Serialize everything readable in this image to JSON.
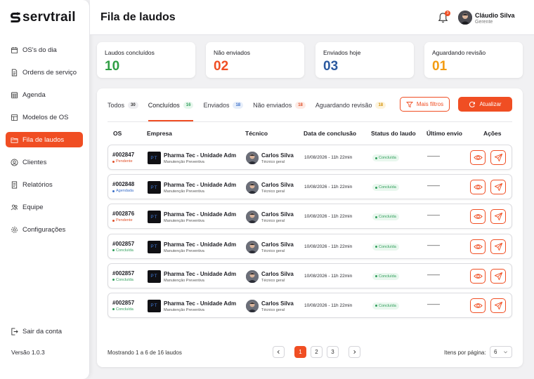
{
  "brand": {
    "name": "servtrail",
    "accent": "#f04e23"
  },
  "sidebar": {
    "items": [
      {
        "label": "OS's do dia",
        "icon": "calendar-icon",
        "active": false
      },
      {
        "label": "Ordens de serviço",
        "icon": "document-icon",
        "active": false
      },
      {
        "label": "Agenda",
        "icon": "calendar-grid-icon",
        "active": false
      },
      {
        "label": "Modelos de OS",
        "icon": "template-icon",
        "active": false
      },
      {
        "label": "Fila de laudos",
        "icon": "folder-icon",
        "active": true
      },
      {
        "label": "Clientes",
        "icon": "user-circle-icon",
        "active": false
      },
      {
        "label": "Relatórios",
        "icon": "report-icon",
        "active": false
      },
      {
        "label": "Equipe",
        "icon": "team-icon",
        "active": false
      },
      {
        "label": "Configurações",
        "icon": "gear-icon",
        "active": false
      }
    ],
    "logout_label": "Sair da conta",
    "version": "Versão 1.0.3"
  },
  "header": {
    "title": "Fila de laudos",
    "notifications_count": "3",
    "user": {
      "name": "Cláudio Silva",
      "role": "Gerente"
    }
  },
  "cards": [
    {
      "label": "Laudos concluídos",
      "value": "10",
      "color": "#2f9e44"
    },
    {
      "label": "Não enviados",
      "value": "02",
      "color": "#f04e23"
    },
    {
      "label": "Enviados hoje",
      "value": "03",
      "color": "#2c5aa0"
    },
    {
      "label": "Aguardando revisão",
      "value": "01",
      "color": "#f39c12"
    }
  ],
  "tabs": [
    {
      "label": "Todos",
      "count": "30",
      "bg": "#ededf0",
      "fg": "#333333",
      "active": false
    },
    {
      "label": "Concluídos",
      "count": "16",
      "bg": "#e6f6ec",
      "fg": "#2f9e5a",
      "active": true
    },
    {
      "label": "Enviados",
      "count": "18",
      "bg": "#e6eefa",
      "fg": "#3b6fc9",
      "active": false
    },
    {
      "label": "Não enviados",
      "count": "18",
      "bg": "#fdeae4",
      "fg": "#e0502a",
      "active": false
    },
    {
      "label": "Aguardando revisão",
      "count": "18",
      "bg": "#fdf3dc",
      "fg": "#d4940c",
      "active": false
    }
  ],
  "buttons": {
    "filters": "Mais filtros",
    "refresh": "Atualizar"
  },
  "table": {
    "headers": [
      "OS",
      "Empresa",
      "Técnico",
      "Data de conclusão",
      "Status do laudo",
      "Último envio",
      "Ações"
    ],
    "rows": [
      {
        "os": "#002847",
        "os_status": "Pendente",
        "os_status_color": "#e0502a",
        "company": "Pharma Tec - Unidade Adm",
        "company_sub": "Manutenção Preventiva",
        "company_logo": "PT",
        "tech": "Carlos Silva",
        "tech_role": "Técnico geral",
        "date": "10/08/2026 - 11h 22min",
        "laudo": "Concluída",
        "last_send": "——"
      },
      {
        "os": "#002848",
        "os_status": "Agendada",
        "os_status_color": "#3b6fc9",
        "company": "Pharma Tec - Unidade Adm",
        "company_sub": "Manutenção Preventiva",
        "company_logo": "PT",
        "tech": "Carlos Silva",
        "tech_role": "Técnico geral",
        "date": "10/08/2026 - 11h 22min",
        "laudo": "Concluída",
        "last_send": "——"
      },
      {
        "os": "#002876",
        "os_status": "Pendente",
        "os_status_color": "#e0502a",
        "company": "Pharma Tec - Unidade Adm",
        "company_sub": "Manutenção Preventiva",
        "company_logo": "PT",
        "tech": "Carlos Silva",
        "tech_role": "Técnico geral",
        "date": "10/08/2026 - 11h 22min",
        "laudo": "Concluída",
        "last_send": "——"
      },
      {
        "os": "#002857",
        "os_status": "Concluída",
        "os_status_color": "#2f9e5a",
        "company": "Pharma Tec - Unidade Adm",
        "company_sub": "Manutenção Preventiva",
        "company_logo": "PT",
        "tech": "Carlos Silva",
        "tech_role": "Técnico geral",
        "date": "10/08/2026 - 11h 22min",
        "laudo": "Concluída",
        "last_send": "——"
      },
      {
        "os": "#002857",
        "os_status": "Concluída",
        "os_status_color": "#2f9e5a",
        "company": "Pharma Tec - Unidade Adm",
        "company_sub": "Manutenção Preventiva",
        "company_logo": "PT",
        "tech": "Carlos Silva",
        "tech_role": "Técnico geral",
        "date": "10/08/2026 - 11h 22min",
        "laudo": "Concluída",
        "last_send": "——"
      },
      {
        "os": "#002857",
        "os_status": "Concluída",
        "os_status_color": "#2f9e5a",
        "company": "Pharma Tec - Unidade Adm",
        "company_sub": "Manutenção Preventiva",
        "company_logo": "PT",
        "tech": "Carlos Silva",
        "tech_role": "Técnico geral",
        "date": "10/08/2026 - 11h 22min",
        "laudo": "Concluída",
        "last_send": "——"
      }
    ]
  },
  "footer": {
    "showing": "Mostrando 1 a 6 de 16 laudos",
    "pages": [
      "1",
      "2",
      "3"
    ],
    "current_page": "1",
    "per_page_label": "Itens por página:",
    "per_page_value": "6"
  }
}
